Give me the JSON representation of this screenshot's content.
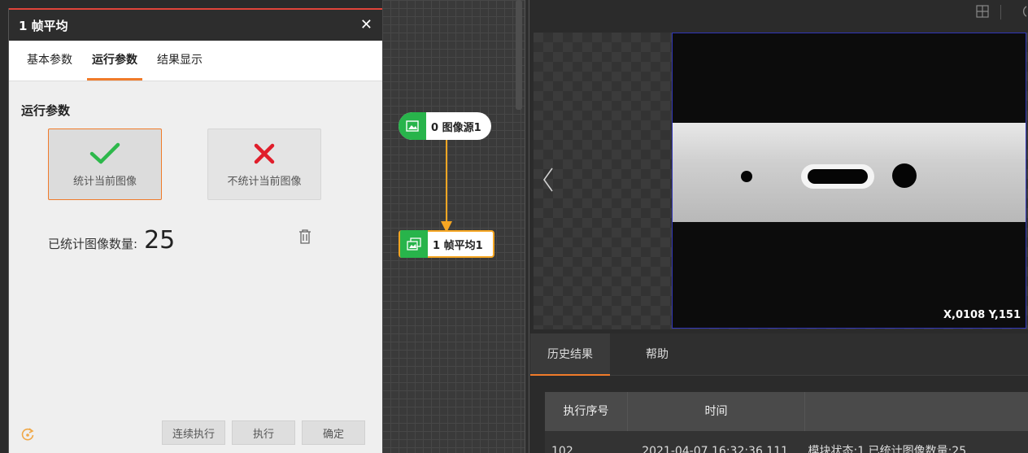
{
  "dialog": {
    "title": "1 帧平均",
    "close_glyph": "✕",
    "tabs": [
      "基本参数",
      "运行参数",
      "结果显示"
    ],
    "active_tab": "运行参数",
    "section_title": "运行参数",
    "options": [
      {
        "label": "统计当前图像",
        "icon": "check-icon",
        "color": "#2db84b",
        "selected": true
      },
      {
        "label": "不统计当前图像",
        "icon": "cross-icon",
        "color": "#e01e2b",
        "selected": false
      }
    ],
    "count_label": "已统计图像数量:",
    "count_value": "25",
    "buttons": {
      "continuous": "连续执行",
      "execute": "执行",
      "confirm": "确定"
    }
  },
  "flow": {
    "nodes": [
      {
        "label": "0 图像源1",
        "icon": "image-icon"
      },
      {
        "label": "1 帧平均1",
        "icon": "frame-average-icon",
        "active": true
      }
    ],
    "accent": "#f5a623"
  },
  "viewer": {
    "coords": "X,0108 Y,151"
  },
  "results": {
    "tabs": [
      "历史结果",
      "帮助"
    ],
    "columns": [
      "执行序号",
      "时间",
      ""
    ],
    "row": {
      "index": "102",
      "time": "2021-04-07 16:32:36.111",
      "text": "模块状态:1,已统计图像数量:25"
    }
  }
}
